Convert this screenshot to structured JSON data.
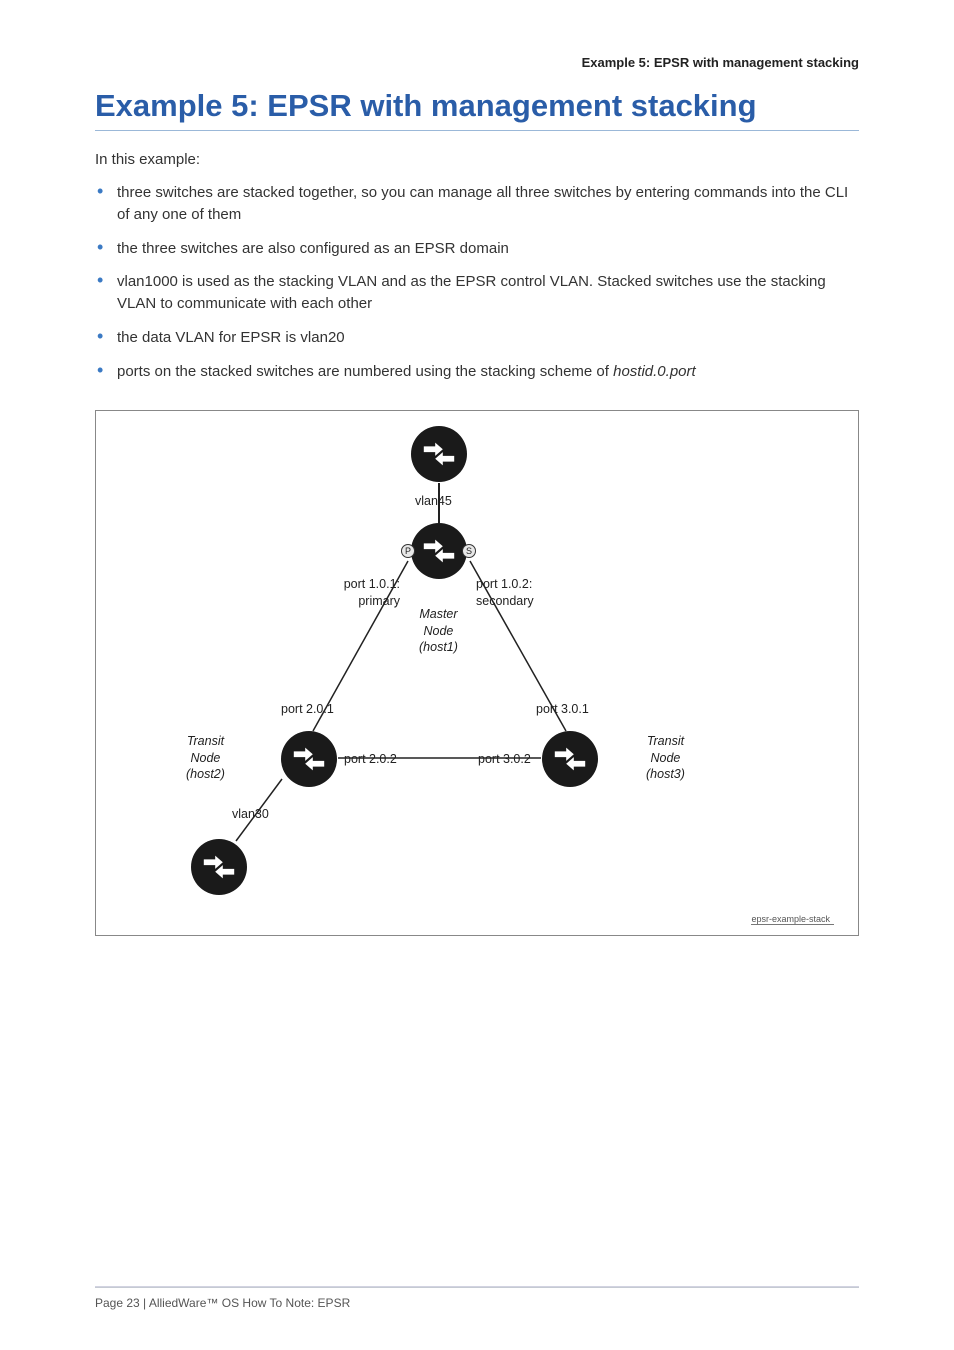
{
  "header": "Example 5: EPSR with management stacking",
  "title": "Example 5: EPSR with management stacking",
  "intro": "In this example:",
  "bullets": [
    "three switches are stacked together, so you can manage all three switches by entering commands into the CLI of any one of them",
    "the three switches are also configured as an EPSR domain",
    "vlan1000 is used as the stacking VLAN and as the EPSR control VLAN. Stacked switches use the stacking VLAN to communicate with each other",
    "the data VLAN for EPSR is vlan20",
    "ports on the stacked switches are numbered using the stacking scheme of "
  ],
  "bullet5_suffix": "hostid.0.port",
  "diagram": {
    "vlan45": "vlan45",
    "port101": "port 1.0.1:\nprimary",
    "port102": "port 1.0.2:\nsecondary",
    "master": "Master\nNode\n(host1)",
    "port201": "port 2.0.1",
    "port301": "port 3.0.1",
    "port202": "port 2.0.2",
    "port302": "port 3.0.2",
    "transit_left": "Transit\nNode\n(host2)",
    "transit_right": "Transit\nNode\n(host3)",
    "vlan30": "vlan30",
    "p_mark": "P",
    "s_mark": "S",
    "caption": "epsr-example-stack"
  },
  "footer": {
    "page": "Page 23 | AlliedWare™ OS How To Note: EPSR"
  }
}
